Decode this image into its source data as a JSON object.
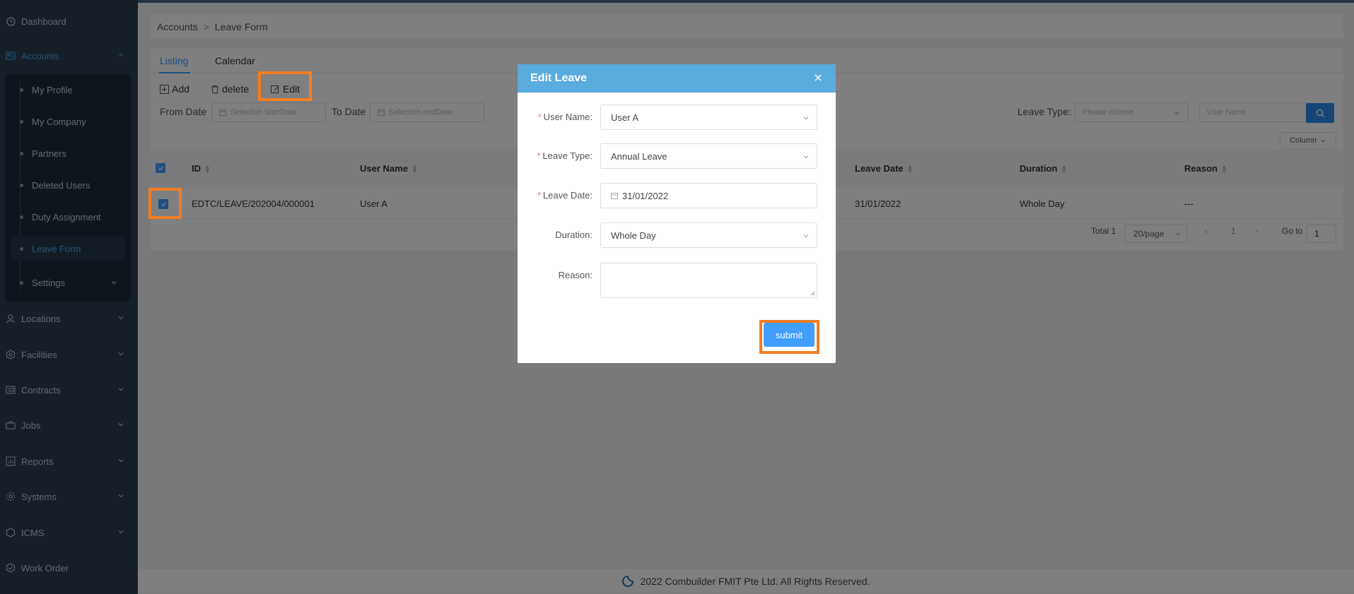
{
  "sidebar": {
    "items": [
      {
        "label": "Dashboard",
        "icon": "dashboard-icon"
      },
      {
        "label": "Accounts",
        "icon": "accounts-icon"
      },
      {
        "label": "Locations",
        "icon": "location-icon"
      },
      {
        "label": "Facilities",
        "icon": "facilities-icon"
      },
      {
        "label": "Contracts",
        "icon": "contracts-icon"
      },
      {
        "label": "Jobs",
        "icon": "jobs-icon"
      },
      {
        "label": "Reports",
        "icon": "reports-icon"
      },
      {
        "label": "Systems",
        "icon": "gear-icon"
      },
      {
        "label": "ICMS",
        "icon": "icms-icon"
      },
      {
        "label": "Work Order",
        "icon": "work-order-icon"
      }
    ],
    "sub_items": [
      {
        "label": "My Profile"
      },
      {
        "label": "My Company"
      },
      {
        "label": "Partners"
      },
      {
        "label": "Deleted Users"
      },
      {
        "label": "Duty Assignment"
      },
      {
        "label": "Leave Form"
      },
      {
        "label": "Settings"
      }
    ]
  },
  "breadcrumb": {
    "root": "Accounts",
    "current": "Leave Form"
  },
  "tabs": [
    {
      "label": "Listing"
    },
    {
      "label": "Calendar"
    }
  ],
  "toolbar": {
    "add": "Add",
    "delete": "delete",
    "edit": "Edit"
  },
  "filters": {
    "from_label": "From Date",
    "from_placeholder": "Selection startDate",
    "to_label": "To Date",
    "to_placeholder": "Selection endDate",
    "leave_type_label": "Leave Type:",
    "leave_type_placeholder": "Please choose",
    "username_placeholder": "User Name",
    "column_btn": "Column"
  },
  "table": {
    "headers": [
      "ID",
      "User Name",
      "Leave Date",
      "Duration",
      "Reason"
    ],
    "rows": [
      {
        "id": "EDTC/LEAVE/202004/000001",
        "user": "User A",
        "date": "31/01/2022",
        "duration": "Whole Day",
        "reason": "---"
      }
    ]
  },
  "pager": {
    "total": "Total 1",
    "per_page": "20/page",
    "page": "1",
    "goto_label": "Go to",
    "goto_value": "1"
  },
  "footer": {
    "text": "2022 Combuilder FMIT Pte Ltd. All Rights Reserved."
  },
  "modal": {
    "title": "Edit Leave",
    "fields": {
      "user_name": {
        "label": "User Name:",
        "value": "User A"
      },
      "leave_type": {
        "label": "Leave Type:",
        "value": "Annual Leave"
      },
      "leave_date": {
        "label": "Leave Date:",
        "value": "31/01/2022"
      },
      "duration": {
        "label": "Duration:",
        "value": "Whole Day"
      },
      "reason": {
        "label": "Reason:",
        "value": ""
      }
    },
    "submit": "submit"
  },
  "colors": {
    "accent": "#409eff",
    "highlight": "#f57c20",
    "sidebar": "#2c3e50",
    "modal_header": "#5aabde"
  }
}
